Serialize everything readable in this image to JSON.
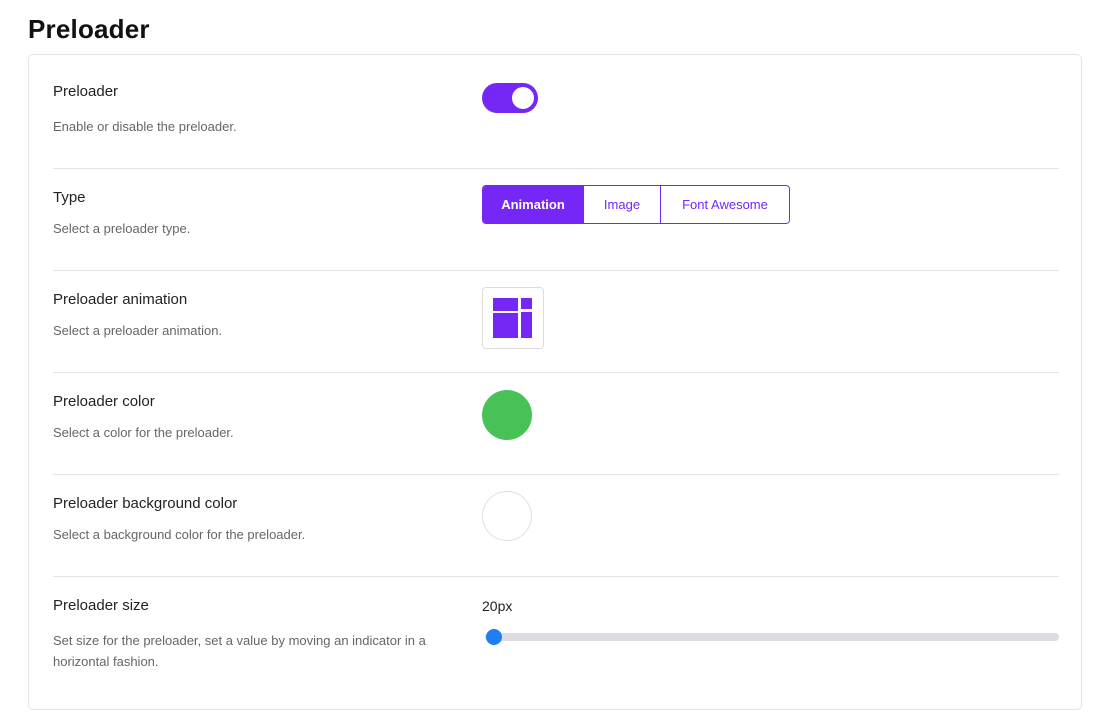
{
  "page": {
    "title": "Preloader"
  },
  "colors": {
    "accent": "#7427f5",
    "preloader_color": "#48c156",
    "preloader_background": "#ffffff",
    "slider_thumb": "#1d7ff2"
  },
  "settings": {
    "enable": {
      "label": "Preloader",
      "description": "Enable or disable the preloader.",
      "enabled": true
    },
    "type": {
      "label": "Type",
      "description": "Select a preloader type.",
      "options": [
        "Animation",
        "Image",
        "Font Awesome"
      ],
      "selected": "Animation"
    },
    "animation": {
      "label": "Preloader animation",
      "description": "Select a preloader animation.",
      "icon": "grid-squares-icon"
    },
    "color": {
      "label": "Preloader color",
      "description": "Select a color for the preloader."
    },
    "background": {
      "label": "Preloader background color",
      "description": "Select a background color for the preloader."
    },
    "size": {
      "label": "Preloader size",
      "description": "Set size for the preloader, set a value by moving an indicator in a horizontal fashion.",
      "value_label": "20px",
      "value_fraction": 0.015
    }
  }
}
